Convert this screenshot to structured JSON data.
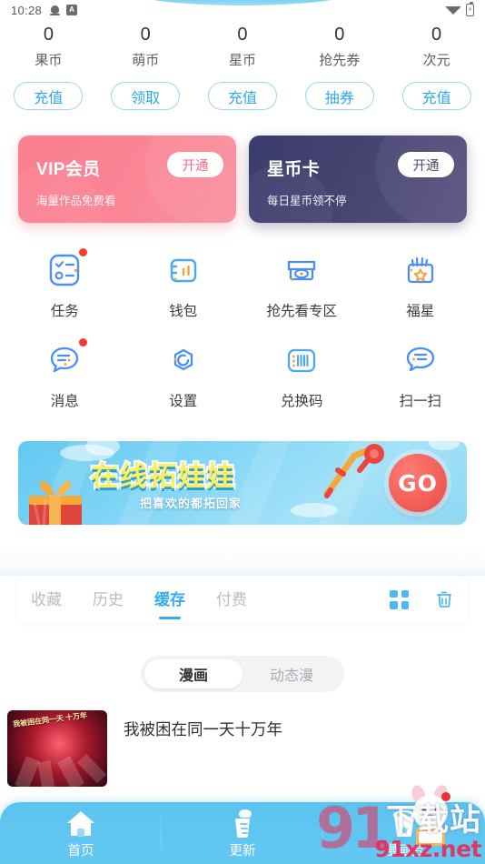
{
  "status_bar": {
    "time": "10:28",
    "icons": [
      "bell-icon",
      "a-badge-icon",
      "wifi-icon",
      "battery-charging-icon"
    ],
    "battery_glyph": "⚡"
  },
  "currencies": [
    {
      "value": "0",
      "label": "果币",
      "action": "充值"
    },
    {
      "value": "0",
      "label": "萌币",
      "action": "领取"
    },
    {
      "value": "0",
      "label": "星币",
      "action": "充值"
    },
    {
      "value": "0",
      "label": "抢先券",
      "action": "抽券"
    },
    {
      "value": "0",
      "label": "次元",
      "action": "充值"
    }
  ],
  "promo_cards": [
    {
      "title": "VIP会员",
      "subtitle": "海量作品免费看",
      "button": "开通",
      "bg_color": "#fa8394",
      "text_color": "#fb6b80"
    },
    {
      "title": "星币卡",
      "subtitle": "每日星币领不停",
      "button": "开通",
      "bg_color": "#45436f",
      "text_color": "#4b4a72"
    }
  ],
  "grid": {
    "row1": [
      {
        "label": "任务",
        "icon": "task-checklist-icon",
        "badge": true
      },
      {
        "label": "钱包",
        "icon": "wallet-icon",
        "badge": false
      },
      {
        "label": "抢先看专区",
        "icon": "early-access-eye-icon",
        "badge": false
      },
      {
        "label": "福星",
        "icon": "lucky-star-bag-icon",
        "badge": false
      }
    ],
    "row2": [
      {
        "label": "消息",
        "icon": "message-bubble-icon",
        "badge": true
      },
      {
        "label": "设置",
        "icon": "settings-gear-icon",
        "badge": false
      },
      {
        "label": "兑换码",
        "icon": "redeem-code-barcode-icon",
        "badge": false
      },
      {
        "label": "扫一扫",
        "icon": "scan-qr-icon",
        "badge": false
      }
    ]
  },
  "banner": {
    "title": "在线拓娃娃",
    "subtitle": "把喜欢的都拓回家",
    "cta": "GO",
    "icons": [
      "gift-box-icon",
      "claw-machine-icon"
    ],
    "title_color": "#fef05a",
    "bg_color": "#7fd5f5"
  },
  "cache_tabs": {
    "items": [
      {
        "label": "收藏",
        "active": false
      },
      {
        "label": "历史",
        "active": false
      },
      {
        "label": "缓存",
        "active": true
      },
      {
        "label": "付费",
        "active": false
      }
    ],
    "actions": [
      {
        "icon": "grid-view-icon"
      },
      {
        "icon": "trash-delete-icon"
      }
    ],
    "accent_color": "#34aaf0"
  },
  "segmented": {
    "items": [
      {
        "label": "漫画",
        "active": true
      },
      {
        "label": "动态漫",
        "active": false
      }
    ]
  },
  "content_list": [
    {
      "title": "我被困在同一天十万年",
      "thumb_caption": "我被困在同一天\n十万年"
    }
  ],
  "bottom_nav": [
    {
      "label": "首页",
      "icon": "home-icon",
      "active": true
    },
    {
      "label": "更新",
      "icon": "update-icon",
      "active": false
    },
    {
      "label": "漫画台",
      "icon": "comic-stage-icon",
      "active": false
    }
  ],
  "watermark": {
    "logo": "91",
    "text_cn": "下载站",
    "url": "91xz.net"
  }
}
